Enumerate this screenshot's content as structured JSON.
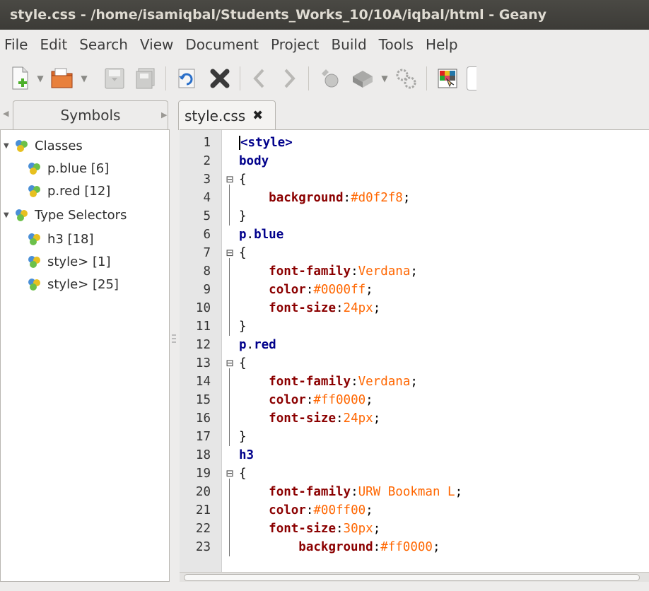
{
  "window": {
    "title": "style.css - /home/isamiqbal/Students_Works_10/10A/iqbal/html - Geany"
  },
  "menu": [
    "File",
    "Edit",
    "Search",
    "View",
    "Document",
    "Project",
    "Build",
    "Tools",
    "Help"
  ],
  "toolbar": {
    "items": [
      "new-file-icon",
      "open-folder-icon",
      "save-icon",
      "save-all-icon",
      "reload-icon",
      "close-file-icon",
      "navigate-back-icon",
      "navigate-forward-icon",
      "compile-icon",
      "build-icon",
      "execute-icon",
      "color-chooser-icon"
    ]
  },
  "sidebar": {
    "tab_label": "Symbols",
    "tree": [
      {
        "label": "Classes",
        "level": 0,
        "expanded": true
      },
      {
        "label": "p.blue [6]",
        "level": 1
      },
      {
        "label": "p.red [12]",
        "level": 1
      },
      {
        "label": "Type Selectors",
        "level": 0,
        "expanded": true
      },
      {
        "label": "h3 [18]",
        "level": 1
      },
      {
        "label": "style> [1]",
        "level": 1
      },
      {
        "label": "style> [25]",
        "level": 1
      }
    ]
  },
  "editor": {
    "tab_label": "style.css",
    "lines": [
      {
        "n": "1",
        "fold": "",
        "code": [
          {
            "t": "<style>",
            "c": "tag"
          }
        ]
      },
      {
        "n": "2",
        "fold": "",
        "code": [
          {
            "t": "body",
            "c": "sel"
          }
        ]
      },
      {
        "n": "3",
        "fold": "⊟",
        "code": [
          {
            "t": "{",
            "c": "punc"
          }
        ]
      },
      {
        "n": "4",
        "fold": "",
        "code": [
          {
            "t": "    "
          },
          {
            "t": "background",
            "c": "prop"
          },
          {
            "t": ":",
            "c": "punc"
          },
          {
            "t": "#d0f2f8",
            "c": "val"
          },
          {
            "t": ";",
            "c": "punc"
          }
        ]
      },
      {
        "n": "5",
        "fold": "",
        "code": [
          {
            "t": "}",
            "c": "punc"
          }
        ]
      },
      {
        "n": "6",
        "fold": "",
        "code": [
          {
            "t": "p",
            "c": "sel"
          },
          {
            "t": ".",
            "c": "punc"
          },
          {
            "t": "blue",
            "c": "sel"
          }
        ]
      },
      {
        "n": "7",
        "fold": "⊟",
        "code": [
          {
            "t": "{",
            "c": "punc"
          }
        ]
      },
      {
        "n": "8",
        "fold": "",
        "code": [
          {
            "t": "    "
          },
          {
            "t": "font-family",
            "c": "prop"
          },
          {
            "t": ":",
            "c": "punc"
          },
          {
            "t": "Verdana",
            "c": "val"
          },
          {
            "t": ";",
            "c": "punc"
          }
        ]
      },
      {
        "n": "9",
        "fold": "",
        "code": [
          {
            "t": "    "
          },
          {
            "t": "color",
            "c": "prop"
          },
          {
            "t": ":",
            "c": "punc"
          },
          {
            "t": "#0000ff",
            "c": "val"
          },
          {
            "t": ";",
            "c": "punc"
          }
        ]
      },
      {
        "n": "10",
        "fold": "",
        "code": [
          {
            "t": "    "
          },
          {
            "t": "font-size",
            "c": "prop"
          },
          {
            "t": ":",
            "c": "punc"
          },
          {
            "t": "24px",
            "c": "val"
          },
          {
            "t": ";",
            "c": "punc"
          }
        ]
      },
      {
        "n": "11",
        "fold": "",
        "code": [
          {
            "t": "}",
            "c": "punc"
          }
        ]
      },
      {
        "n": "12",
        "fold": "",
        "code": [
          {
            "t": "p",
            "c": "sel"
          },
          {
            "t": ".",
            "c": "punc"
          },
          {
            "t": "red",
            "c": "sel"
          }
        ]
      },
      {
        "n": "13",
        "fold": "⊟",
        "code": [
          {
            "t": "{",
            "c": "punc"
          }
        ]
      },
      {
        "n": "14",
        "fold": "",
        "code": [
          {
            "t": "    "
          },
          {
            "t": "font-family",
            "c": "prop"
          },
          {
            "t": ":",
            "c": "punc"
          },
          {
            "t": "Verdana",
            "c": "val"
          },
          {
            "t": ";",
            "c": "punc"
          }
        ]
      },
      {
        "n": "15",
        "fold": "",
        "code": [
          {
            "t": "    "
          },
          {
            "t": "color",
            "c": "prop"
          },
          {
            "t": ":",
            "c": "punc"
          },
          {
            "t": "#ff0000",
            "c": "val"
          },
          {
            "t": ";",
            "c": "punc"
          }
        ]
      },
      {
        "n": "16",
        "fold": "",
        "code": [
          {
            "t": "    "
          },
          {
            "t": "font-size",
            "c": "prop"
          },
          {
            "t": ":",
            "c": "punc"
          },
          {
            "t": "24px",
            "c": "val"
          },
          {
            "t": ";",
            "c": "punc"
          }
        ]
      },
      {
        "n": "17",
        "fold": "",
        "code": [
          {
            "t": "}",
            "c": "punc"
          }
        ]
      },
      {
        "n": "18",
        "fold": "",
        "code": [
          {
            "t": "h3",
            "c": "sel"
          }
        ]
      },
      {
        "n": "19",
        "fold": "⊟",
        "code": [
          {
            "t": "{",
            "c": "punc"
          }
        ]
      },
      {
        "n": "20",
        "fold": "",
        "code": [
          {
            "t": "    "
          },
          {
            "t": "font-family",
            "c": "prop"
          },
          {
            "t": ":",
            "c": "punc"
          },
          {
            "t": "URW Bookman L",
            "c": "val"
          },
          {
            "t": ";",
            "c": "punc"
          }
        ]
      },
      {
        "n": "21",
        "fold": "",
        "code": [
          {
            "t": "    "
          },
          {
            "t": "color",
            "c": "prop"
          },
          {
            "t": ":",
            "c": "punc"
          },
          {
            "t": "#00ff00",
            "c": "val"
          },
          {
            "t": ";",
            "c": "punc"
          }
        ]
      },
      {
        "n": "22",
        "fold": "",
        "code": [
          {
            "t": "    "
          },
          {
            "t": "font-size",
            "c": "prop"
          },
          {
            "t": ":",
            "c": "punc"
          },
          {
            "t": "30px",
            "c": "val"
          },
          {
            "t": ";",
            "c": "punc"
          }
        ]
      },
      {
        "n": "23",
        "fold": "",
        "code": [
          {
            "t": "        "
          },
          {
            "t": "background",
            "c": "prop"
          },
          {
            "t": ":",
            "c": "punc"
          },
          {
            "t": "#ff0000",
            "c": "val"
          },
          {
            "t": ";",
            "c": "punc"
          }
        ]
      }
    ]
  },
  "colors": {
    "selector": "#00008b",
    "property": "#8b0000",
    "value": "#ff6600",
    "gutter": "#e6e6e6",
    "titlebar": "#3c3b37"
  }
}
